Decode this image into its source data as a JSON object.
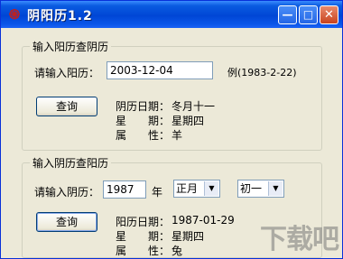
{
  "window": {
    "title": "阴阳历1.2",
    "app_icon": "swirl-icon"
  },
  "controls": {
    "minimize": "—",
    "maximize": "□",
    "close": "✕"
  },
  "section1": {
    "title": "输入阳历查阴历",
    "input_label": "请输入阳历：",
    "input_value": "2003-12-04",
    "example": "例(1983-2-22)",
    "query_button": "查询",
    "result": {
      "date_label": "阴历日期：",
      "date_value": "冬月十一",
      "week_label": "星　　期：",
      "week_value": "星期四",
      "zodiac_label": "属　　性：",
      "zodiac_value": "羊"
    }
  },
  "section2": {
    "title": "输入阴历查阳历",
    "input_label": "请输入阴历：",
    "year_value": "1987",
    "year_unit": "年",
    "month_value": "正月",
    "day_value": "初一",
    "query_button": "查询",
    "result": {
      "date_label": "阳历日期：",
      "date_value": "1987-01-29",
      "week_label": "星　　期：",
      "week_value": "星期四",
      "zodiac_label": "属　　性：",
      "zodiac_value": "兔"
    }
  },
  "watermark": "下载吧"
}
